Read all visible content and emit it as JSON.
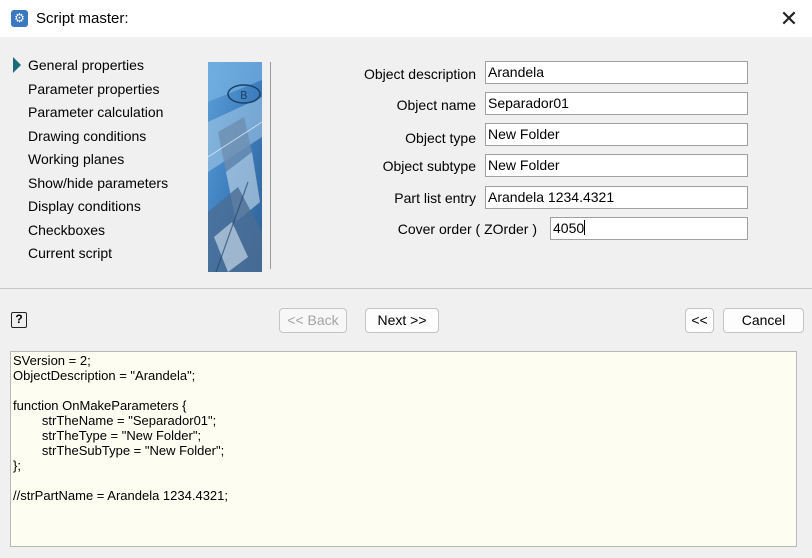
{
  "window": {
    "title": "Script master:",
    "close_glyph": "✕",
    "icon": "gear-icon"
  },
  "nav": {
    "items": [
      {
        "label": "General properties",
        "selected": true
      },
      {
        "label": "Parameter properties"
      },
      {
        "label": "Parameter calculation"
      },
      {
        "label": "Drawing conditions"
      },
      {
        "label": "Working planes"
      },
      {
        "label": "Show/hide parameters"
      },
      {
        "label": "Display conditions"
      },
      {
        "label": "Checkboxes"
      },
      {
        "label": "Current script"
      }
    ]
  },
  "form": {
    "object_description": {
      "label": "Object description",
      "value": "Arandela"
    },
    "object_name": {
      "label": "Object name",
      "value": "Separador01"
    },
    "object_type": {
      "label": "Object type",
      "value": "New Folder"
    },
    "object_subtype": {
      "label": "Object subtype",
      "value": "New Folder"
    },
    "part_list_entry": {
      "label": "Part list entry",
      "value": "Arandela 1234.4321"
    },
    "cover_order": {
      "label": "Cover order ( ZOrder )",
      "value": "4050"
    }
  },
  "buttons": {
    "help": "?",
    "back": "<< Back",
    "next": "Next >>",
    "collapse": "<<",
    "cancel": "Cancel"
  },
  "script": "SVersion = 2;\nObjectDescription = \"Arandela\";\n\nfunction OnMakeParameters {\n\tstrTheName = \"Separador01\";\n\tstrTheType = \"New Folder\";\n\tstrTheSubType = \"New Folder\";\n};\n\n//strPartName = Arandela 1234.4321;"
}
